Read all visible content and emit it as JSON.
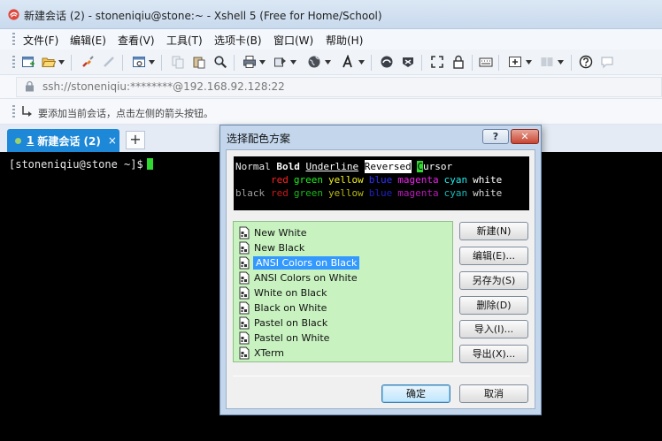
{
  "window": {
    "title": "新建会话 (2) - stoneniqiu@stone:~ - Xshell 5 (Free for Home/School)"
  },
  "menu": [
    "文件(F)",
    "编辑(E)",
    "查看(V)",
    "工具(T)",
    "选项卡(B)",
    "窗口(W)",
    "帮助(H)"
  ],
  "address": {
    "text": "ssh://stoneniqiu:********@192.168.92.128:22"
  },
  "hint": {
    "text": "要添加当前会话，点击左侧的箭头按钮。"
  },
  "tabs": {
    "active_number": "1",
    "active_label": "新建会话 (2)",
    "close_glyph": "×",
    "add_glyph": "+"
  },
  "terminal": {
    "prompt": "[stoneniqiu@stone ~]$"
  },
  "dialog": {
    "title": "选择配色方案",
    "help_glyph": "?",
    "close_glyph": "✕",
    "preview": {
      "row1": {
        "normal": "Normal",
        "bold": "Bold",
        "underline": "Underline",
        "reversed": "Reversed",
        "cursor_char": "C",
        "cursor_rest": "ursor"
      },
      "row2_label": "",
      "row3_label": "black",
      "colors": [
        {
          "name": "red",
          "color": "#ff2020"
        },
        {
          "name": "green",
          "color": "#20ee20"
        },
        {
          "name": "yellow",
          "color": "#f0f020"
        },
        {
          "name": "blue",
          "color": "#3030ff"
        },
        {
          "name": "magenta",
          "color": "#ee20ee"
        },
        {
          "name": "cyan",
          "color": "#20eeee"
        },
        {
          "name": "white",
          "color": "#ffffff"
        }
      ],
      "dim_colors": [
        {
          "name": "red",
          "color": "#c81818"
        },
        {
          "name": "green",
          "color": "#18b818"
        },
        {
          "name": "yellow",
          "color": "#b8b818"
        },
        {
          "name": "blue",
          "color": "#2020c0"
        },
        {
          "name": "magenta",
          "color": "#b818b8"
        },
        {
          "name": "cyan",
          "color": "#18b8b8"
        },
        {
          "name": "white",
          "color": "#d8d8d8"
        }
      ],
      "black_label_color": "#a0a0a0"
    },
    "schemes": [
      "New White",
      "New Black",
      "ANSI Colors on Black",
      "ANSI Colors on White",
      "White on Black",
      "Black on White",
      "Pastel on Black",
      "Pastel on White",
      "XTerm"
    ],
    "selected_index": 2,
    "buttons": {
      "new": "新建(N)",
      "edit": "编辑(E)...",
      "save_as": "另存为(S)",
      "delete": "删除(D)",
      "import": "导入(I)...",
      "export": "导出(X)...",
      "ok": "确定",
      "cancel": "取消"
    }
  },
  "colors": {
    "tab_active": "#1e88d8",
    "list_bg": "#c8f2c0",
    "selection": "#3399ff",
    "cursor": "#2fd92f"
  }
}
